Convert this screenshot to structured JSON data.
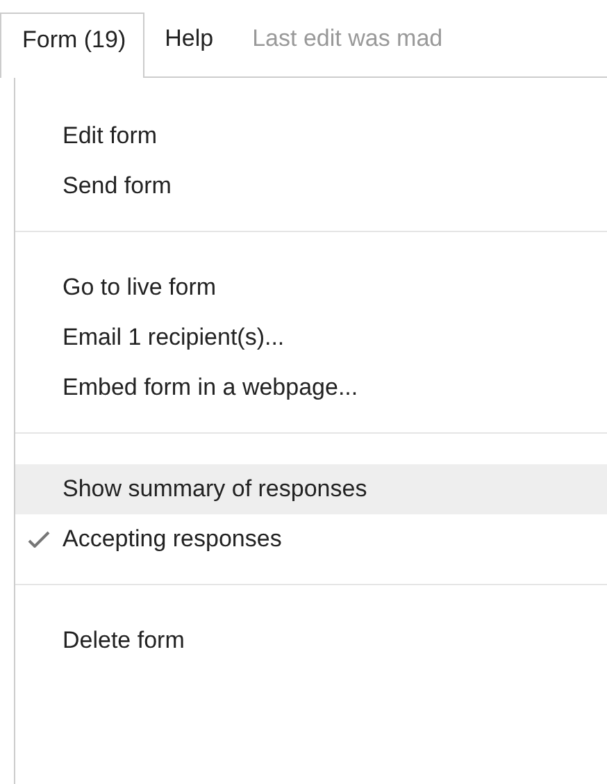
{
  "menubar": [
    {
      "label": "Form (19)",
      "selected": true
    },
    {
      "label": "Help",
      "selected": false
    }
  ],
  "status": "Last edit was mad",
  "menu_groups": [
    [
      {
        "label": "Edit form",
        "checked": false,
        "selected": false
      },
      {
        "label": "Send form",
        "checked": false,
        "selected": false
      }
    ],
    [
      {
        "label": "Go to live form",
        "checked": false,
        "selected": false
      },
      {
        "label": "Email 1 recipient(s)...",
        "checked": false,
        "selected": false
      },
      {
        "label": "Embed form in a webpage...",
        "checked": false,
        "selected": false
      }
    ],
    [
      {
        "label": "Show summary of responses",
        "checked": false,
        "selected": true
      },
      {
        "label": "Accepting responses",
        "checked": true,
        "selected": false
      }
    ],
    [
      {
        "label": "Delete form",
        "checked": false,
        "selected": false
      }
    ]
  ]
}
